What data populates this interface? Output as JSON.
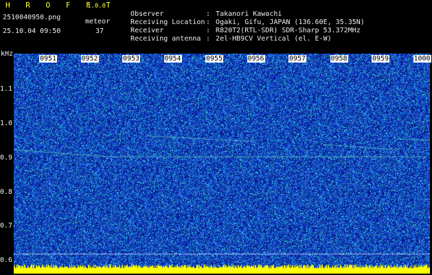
{
  "header": {
    "app_title": "H R O F F T",
    "app_version": "1.0.0",
    "file_name": "2510040950.png",
    "datetime": "25.10.04 09:50",
    "meteor_label": "meteor",
    "meteor_count": "37"
  },
  "info": [
    {
      "label": "Observer",
      "value": "Takanori Kawachi"
    },
    {
      "label": "Receiving Location",
      "value": "Ogaki, Gifu, JAPAN (136.60E, 35.35N)"
    },
    {
      "label": "Receiver",
      "value": "R820T2(RTL-SDR) SDR-Sharp 53.372MHz"
    },
    {
      "label": "Receiving antenna",
      "value": "2el-HB9CV Vertical (el. E-W)"
    }
  ],
  "separator": ":",
  "axis": {
    "y_unit": "kHz",
    "y_ticks": [
      "1.1",
      "1.0",
      "0.9",
      "0.8",
      "0.7",
      "0.6"
    ],
    "x_ticks": [
      "0951",
      "0952",
      "0953",
      "0954",
      "0955",
      "0956",
      "0957",
      "0958",
      "0959",
      "1000"
    ]
  },
  "colors": {
    "background": "#000000",
    "plot_bg": "#0d2bb0",
    "title": "#ffff3c",
    "meta": "#2de0e0",
    "text": "#f0f0f0",
    "noise_floor": "#ffff00"
  }
}
